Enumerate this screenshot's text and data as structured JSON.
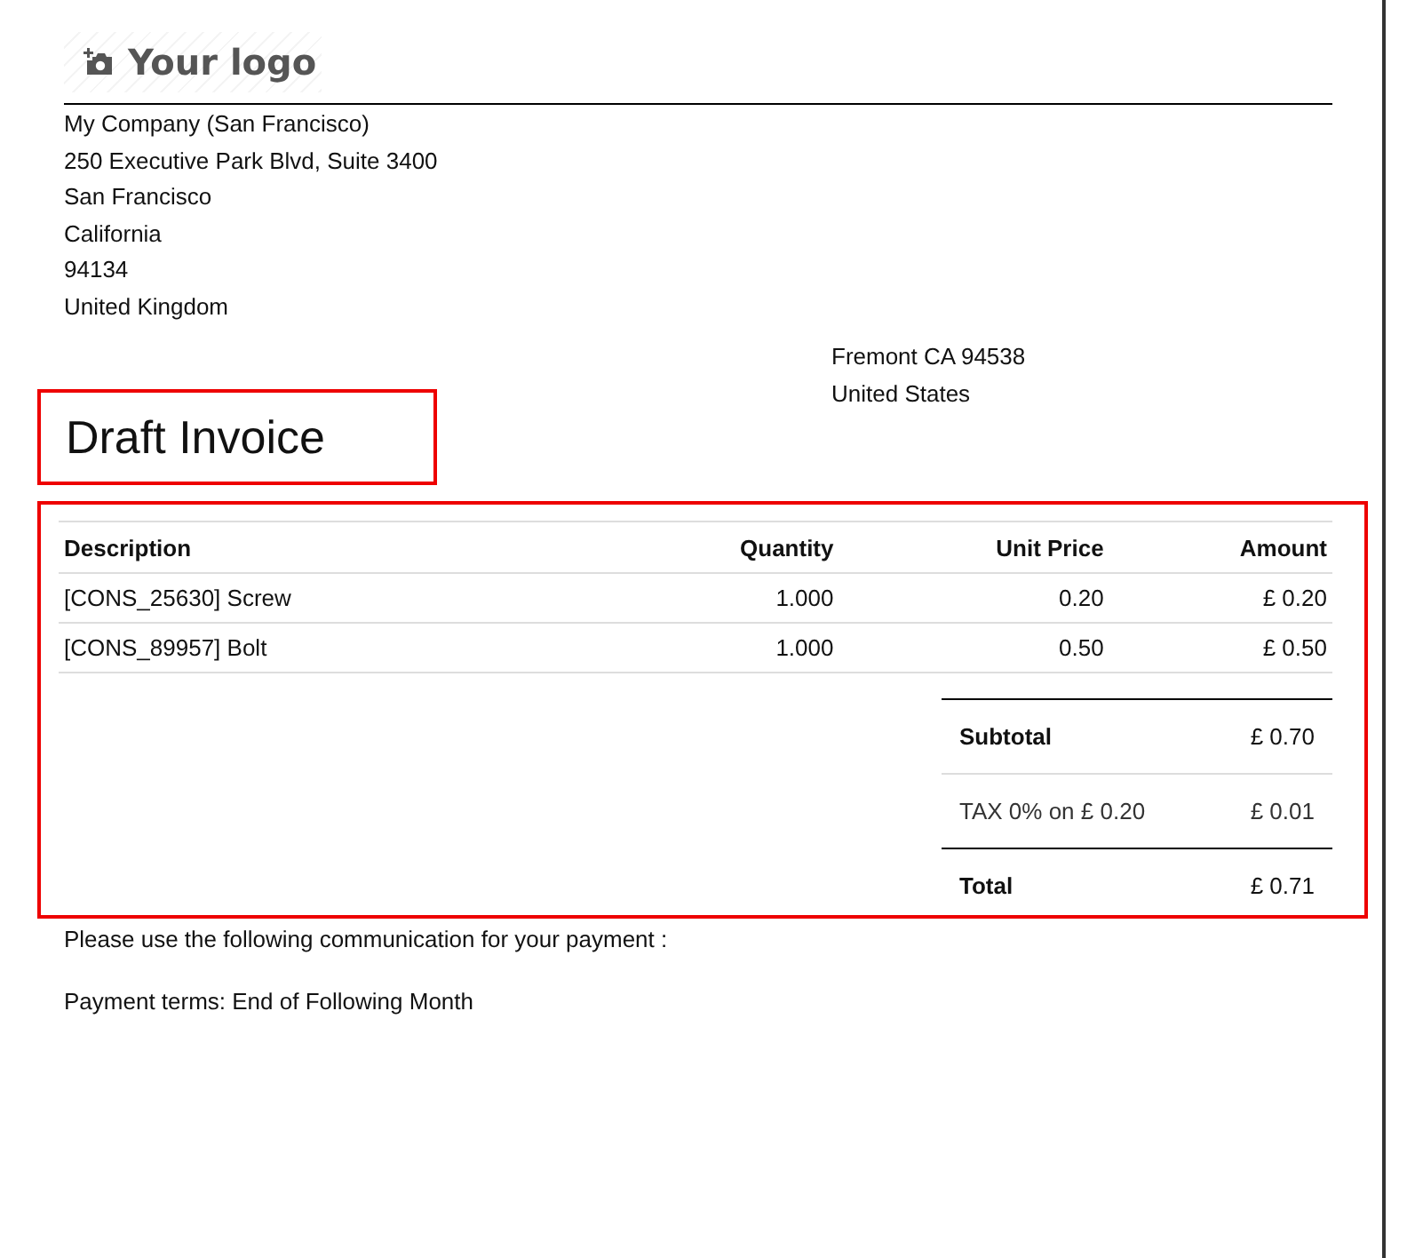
{
  "logo": {
    "text": "Your logo"
  },
  "company": [
    "My Company (San Francisco)",
    "250 Executive Park Blvd, Suite 3400",
    "San Francisco",
    "California",
    "94134",
    "United Kingdom"
  ],
  "customer_address": [
    "Fremont CA 94538",
    "United States"
  ],
  "title": "Draft Invoice",
  "table": {
    "columns": [
      "Description",
      "Quantity",
      "Unit Price",
      "Amount"
    ],
    "rows": [
      [
        "[CONS_25630] Screw",
        "1.000",
        "0.20",
        "£ 0.20"
      ],
      [
        "[CONS_89957] Bolt",
        "1.000",
        "0.50",
        "£ 0.50"
      ]
    ]
  },
  "totals": [
    {
      "kind": "strong",
      "label": "Subtotal",
      "value": "£ 0.70"
    },
    {
      "kind": "tax",
      "label": "TAX 0%  on £ 0.20",
      "value": "£ 0.01"
    },
    {
      "kind": "strong",
      "label": "Total",
      "value": "£ 0.71"
    }
  ],
  "notes": [
    "Please use the following communication for your payment :",
    "Payment terms: End of Following Month"
  ]
}
